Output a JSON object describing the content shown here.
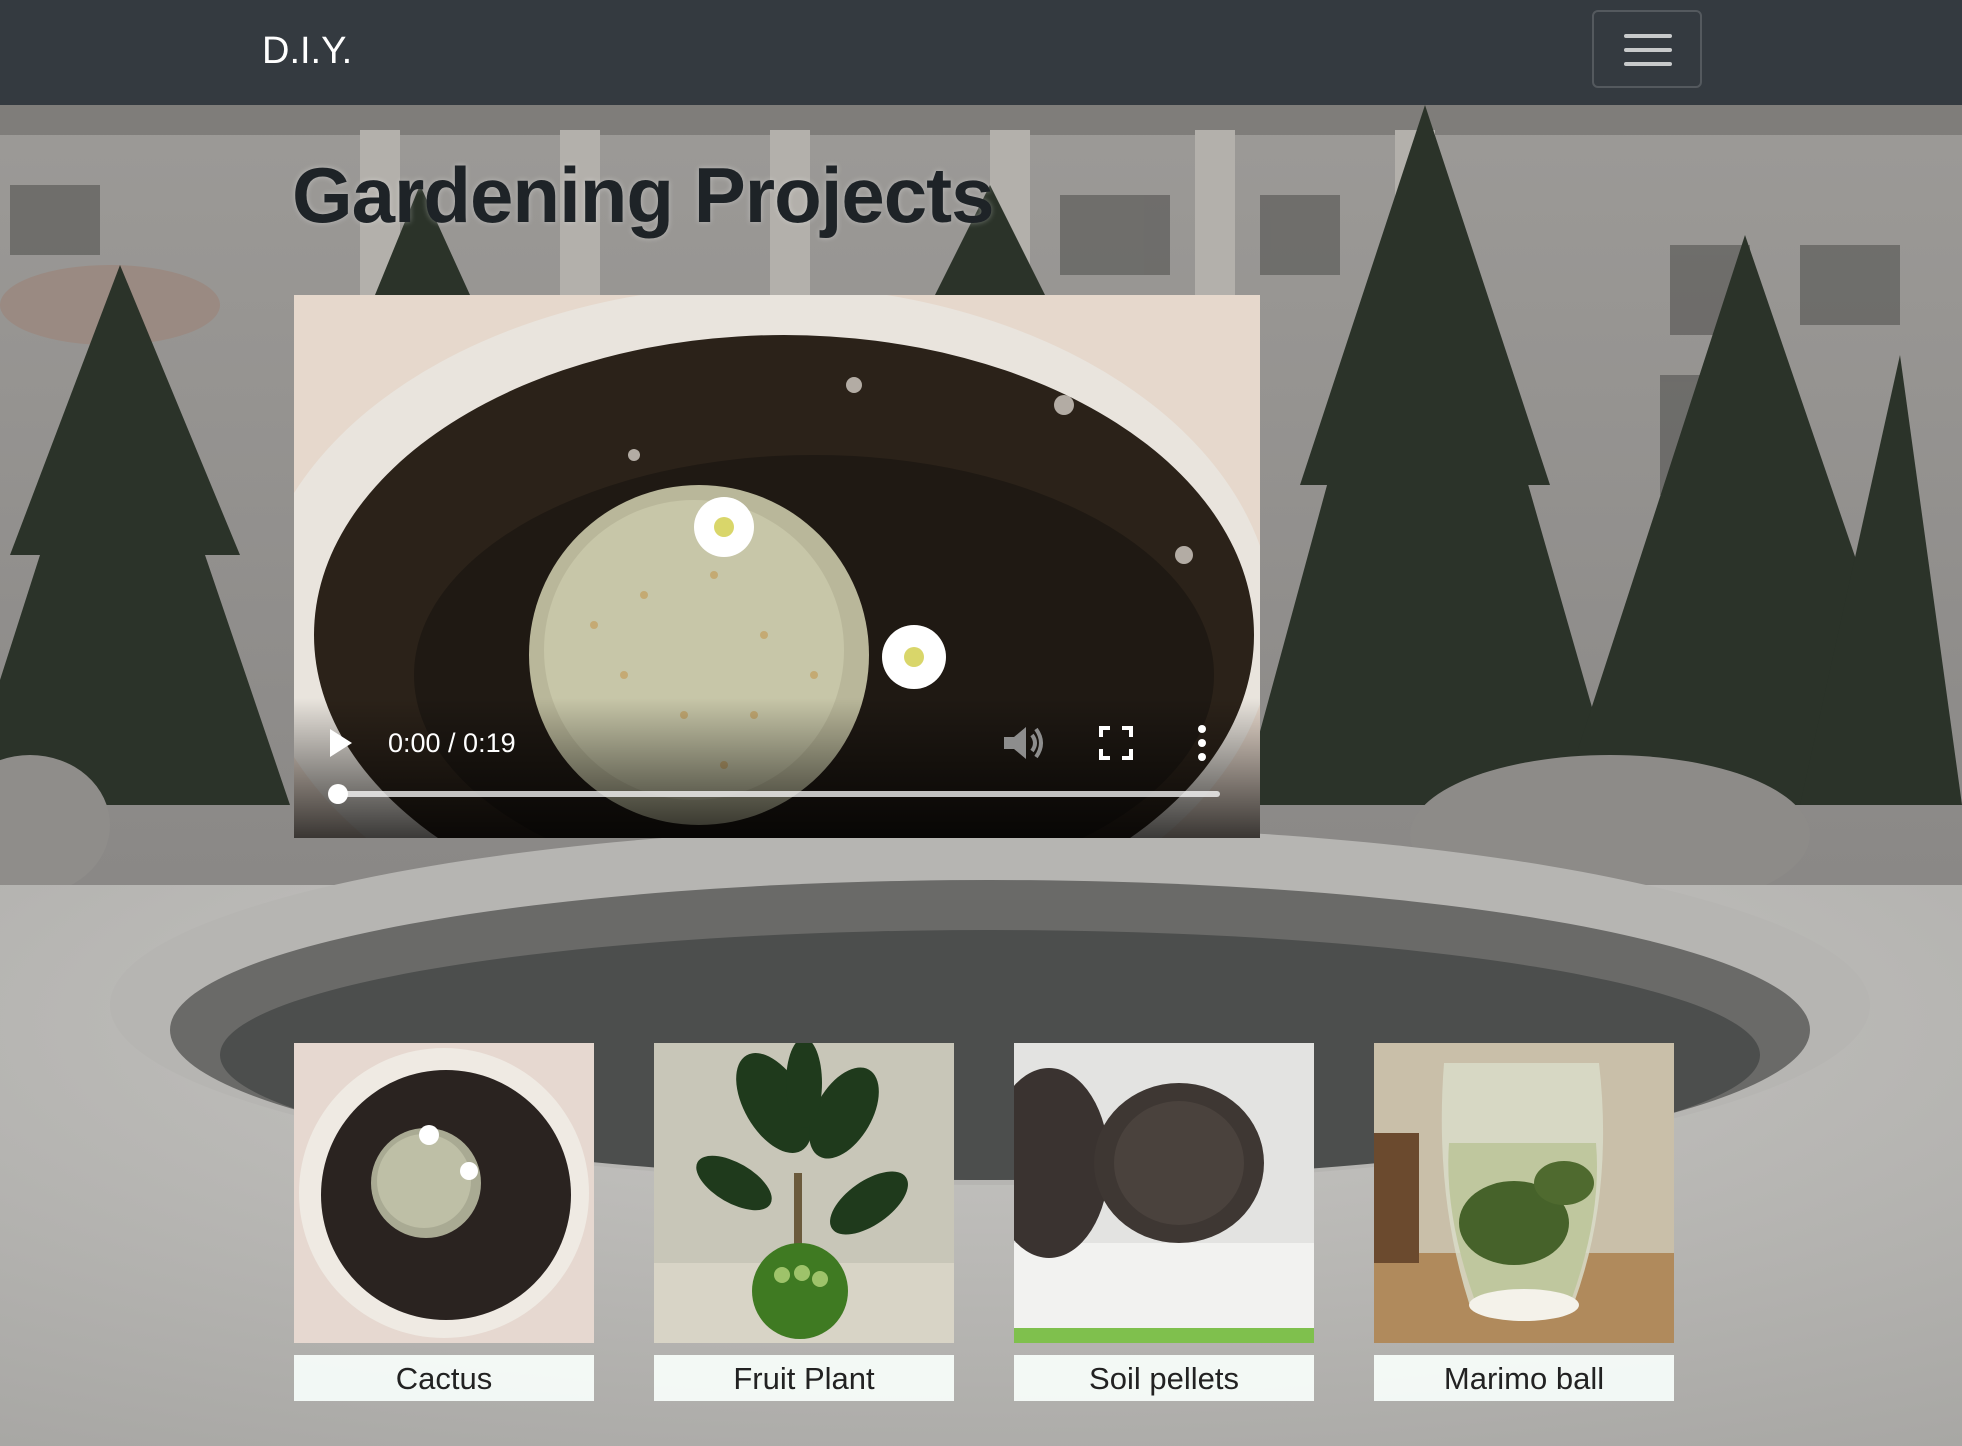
{
  "navbar": {
    "brand": "D.I.Y.",
    "toggler_icon": "hamburger-icon"
  },
  "page": {
    "title": "Gardening Projects"
  },
  "video": {
    "time_display": "0:00 / 0:19",
    "progress": 0.0,
    "icons": [
      "play-icon",
      "volume-icon",
      "fullscreen-icon",
      "more-options-icon"
    ]
  },
  "gallery": {
    "items": [
      {
        "label": "Cactus"
      },
      {
        "label": "Fruit Plant"
      },
      {
        "label": "Soil pellets"
      },
      {
        "label": "Marimo ball"
      }
    ]
  },
  "colors": {
    "navbar_bg": "#343a40",
    "caption_bg": "#f7fdfa",
    "title_text": "#1e2327"
  }
}
